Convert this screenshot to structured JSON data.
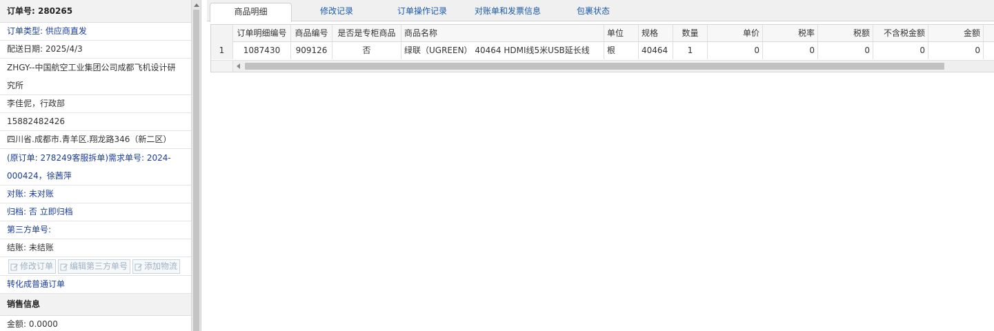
{
  "order": {
    "number_label": "订单号: 280265",
    "type": "订单类型: 供应商直发",
    "delivery_date": "配送日期: 2025/4/3",
    "customer_line1": "ZHGY--中国航空工业集团公司成都飞机设计研",
    "customer_line2": "究所",
    "contact": "李佳伲，行政部",
    "phone": "15882482426",
    "address": "四川省.成都市.青羊区.翔龙路346（新二区）",
    "origin_line1": "(原订单: 278249客服拆单)需求单号: 2024-",
    "origin_line2": "000424，徐茜萍",
    "reconcile": "对账: 未对账",
    "archive": "归档:  否 立即归档",
    "third_party": "第三方单号:",
    "settlement": "结账: 未结账",
    "buttons": {
      "edit_order": "修改订单",
      "edit_third_party": "编辑第三方单号",
      "add_logistics": "添加物流"
    },
    "convert_link": "转化成普通订单"
  },
  "sales": {
    "title": "销售信息",
    "amount": "金额: 0.0000"
  },
  "tabs": [
    {
      "label": "商品明细",
      "active": true
    },
    {
      "label": "修改记录",
      "active": false
    },
    {
      "label": "订单操作记录",
      "active": false
    },
    {
      "label": "对账单和发票信息",
      "active": false
    },
    {
      "label": "包裹状态",
      "active": false
    }
  ],
  "grid": {
    "columns": [
      "订单明细编号",
      "商品编号",
      "是否是专柜商品",
      "商品名称",
      "单位",
      "规格",
      "数量",
      "单价",
      "税率",
      "税额",
      "不含税金额",
      "金额"
    ],
    "rows": [
      {
        "index": "1",
        "detail_id": "1087430",
        "product_id": "909126",
        "counter": "否",
        "name": "绿联（UGREEN） 40464 HDMI线5米USB延长线",
        "unit": "根",
        "spec": "40464",
        "qty": "1",
        "price": "0",
        "tax_rate": "0",
        "tax": "0",
        "net_amount": "0",
        "amount": "0"
      }
    ]
  },
  "colors": {
    "link_blue": "#1a3c9e",
    "tab_blue": "#1a5aa8",
    "button_disabled": "#9fb2c4"
  }
}
